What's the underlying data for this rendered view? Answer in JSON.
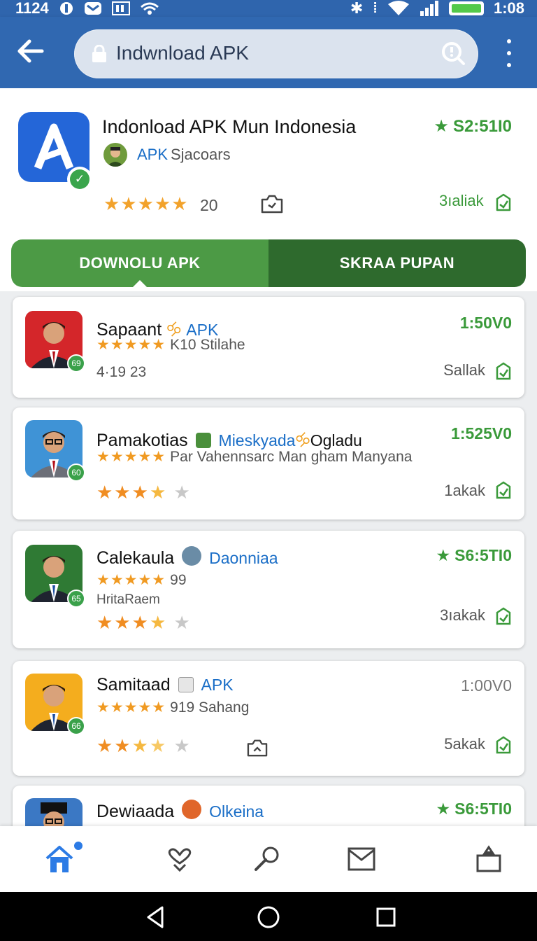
{
  "status_bar": {
    "left_text": "1124",
    "time": "1:08"
  },
  "search": {
    "text": "Indwnload APK"
  },
  "hero": {
    "title": "Indonload APK Mun Indonesia",
    "dev_tag": "APK",
    "dev_name": "Sjacoars",
    "stars": "★★★★★",
    "count": "20",
    "price": "S2:51I0",
    "size": "3ıaliak"
  },
  "tabs": {
    "download": "DOWNOLU APK",
    "secondary": "SKRAA PUPAN"
  },
  "cards": [
    {
      "name": "Sapaant",
      "tag": "APK",
      "stars_text": "★★★★★",
      "line2": "K10 Stilahe",
      "line3": "4·19  23",
      "price": "1:50V0",
      "size": "Sallak",
      "badge": "69"
    },
    {
      "name": "Pamakotias",
      "tag": "Mieskyada",
      "tag_extra": "Ogladu",
      "stars_text": "★★★★★",
      "line2": "Par Vahennsarc Man gham Manyana",
      "price": "1:525V0",
      "size": "1akak",
      "badge": "60"
    },
    {
      "name": "Calekaula",
      "tag": "Daonniaa",
      "stars_text": "★★★★★",
      "line2": "99",
      "line3": "HritaRaem",
      "price": "S6:5TI0",
      "size": "3ıakak",
      "badge": "65"
    },
    {
      "name": "Samitaad",
      "tag": "APK",
      "stars_text": "★★★★★",
      "line2": "919 Sahang",
      "price": "1:00V0",
      "size": "5akak",
      "badge": "66"
    },
    {
      "name": "Dewiaada",
      "tag": "Olkeina",
      "price": "S6:5TI0"
    }
  ],
  "colors": {
    "primary": "#3068b1",
    "green": "#3a9a3a",
    "tab_dark": "#2e6a2d",
    "tab_light": "#4c9a45",
    "star": "#f09a22"
  },
  "icons": [
    "arrow-left-icon",
    "lock-icon",
    "search-icon",
    "more-vert-icon",
    "home-icon",
    "heart-hands-icon",
    "search-key-icon",
    "mail-icon",
    "bag-icon"
  ]
}
